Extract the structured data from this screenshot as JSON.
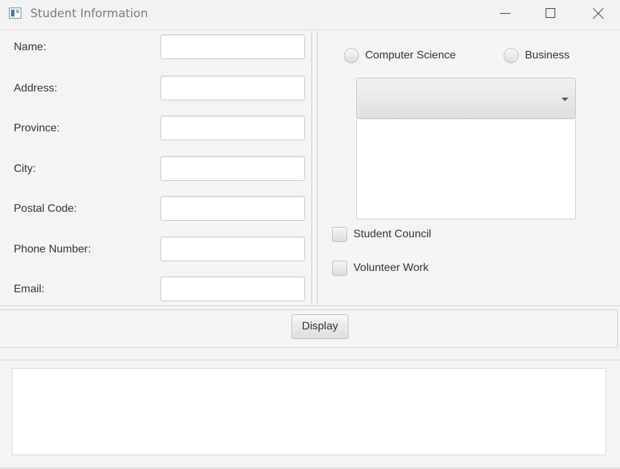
{
  "window": {
    "title": "Student Information",
    "icon": "app-window-icon"
  },
  "form": {
    "fields": [
      {
        "label": "Name:",
        "value": ""
      },
      {
        "label": "Address:",
        "value": ""
      },
      {
        "label": "Province:",
        "value": ""
      },
      {
        "label": "City:",
        "value": ""
      },
      {
        "label": "Postal Code:",
        "value": ""
      },
      {
        "label": "Phone Number:",
        "value": ""
      },
      {
        "label": "Email:",
        "value": ""
      }
    ]
  },
  "program": {
    "options": [
      {
        "label": "Computer Science",
        "selected": false
      },
      {
        "label": "Business",
        "selected": false
      }
    ],
    "combo_value": "",
    "list_items": []
  },
  "activities": [
    {
      "label": "Student Council",
      "checked": false
    },
    {
      "label": "Volunteer Work",
      "checked": false
    }
  ],
  "actions": {
    "display_label": "Display"
  },
  "output": {
    "text": ""
  }
}
